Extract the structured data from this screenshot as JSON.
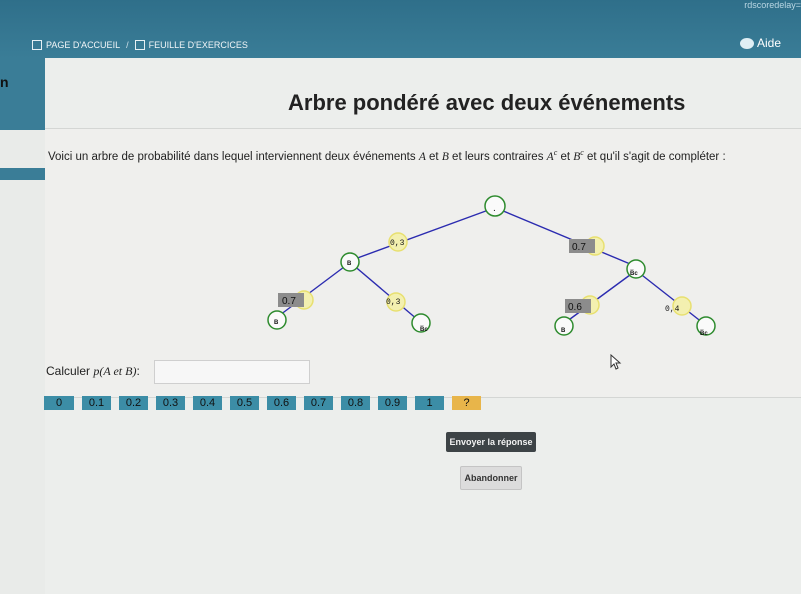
{
  "header": {
    "url_fragment": "rdscoredelay=",
    "breadcrumb": [
      {
        "label": "PAGE D'ACCUEIL"
      },
      {
        "label": "FEUILLE D'EXERCICES"
      }
    ],
    "separator": "/",
    "help_label": "Aide",
    "side_text": "n"
  },
  "exercise": {
    "title": "Arbre pondéré avec deux événements",
    "intro_start": "Voici un arbre de probabilité dans lequel interviennent deux événements ",
    "var_a": "A",
    "intro_and1": " et ",
    "var_b": "B",
    "intro_mid": " et leurs contraires ",
    "var_ac": "A",
    "sup_c": "c",
    "intro_and2": " et ",
    "var_bc": "B",
    "intro_end": " et qu'il s'agit de compléter :"
  },
  "tree": {
    "root_label": ".",
    "left_weight": "0,3",
    "right_weight": "0.7",
    "node_left_label": "B",
    "node_right_label": "B̅c",
    "ll_weight": "0.7",
    "lr_weight": "0,3",
    "rl_weight": "0.6",
    "rr_weight": "0,4",
    "leaf_ll_label": "B",
    "leaf_lr_label": "B̅c",
    "leaf_rl_label": "B",
    "leaf_rr_label": "B̅c",
    "colors": {
      "edge": "#2b2bb0",
      "node": "#2e8b2e",
      "highlight": "#e8e070",
      "weight_box": "#8c8c8c"
    }
  },
  "calc": {
    "prefix": "Calculer ",
    "expression": "p(A et B)",
    "suffix": ":",
    "input_value": ""
  },
  "choices": [
    "0",
    "0.1",
    "0.2",
    "0.3",
    "0.4",
    "0.5",
    "0.6",
    "0.7",
    "0.8",
    "0.9",
    "1",
    "?"
  ],
  "buttons": {
    "send": "Envoyer la réponse",
    "cancel": "Abandonner"
  }
}
